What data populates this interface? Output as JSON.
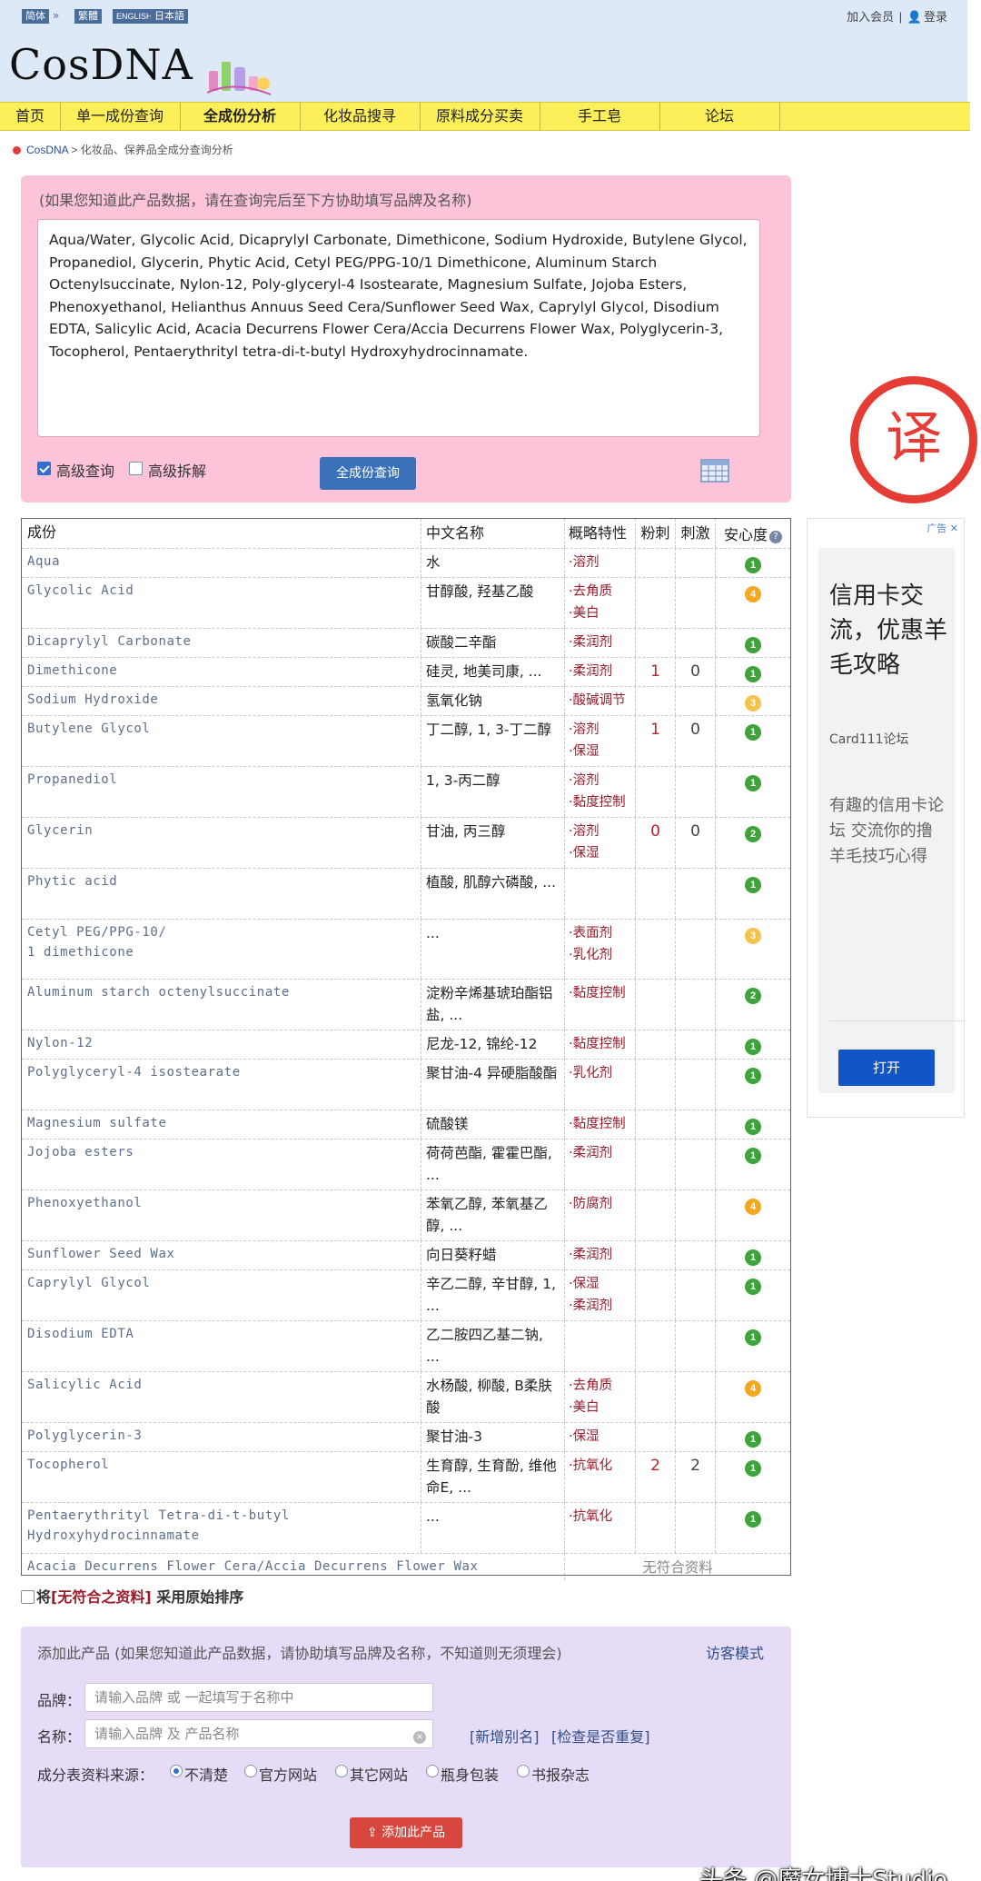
{
  "header": {
    "languages": [
      "简体",
      "繁體",
      "ENGLISH",
      "日本語"
    ],
    "join_member": "加入会员",
    "separator": "|",
    "login": "登录",
    "logo_text": "CosDNA"
  },
  "nav": {
    "items": [
      "首页",
      "单一成份查询",
      "全成份分析",
      "化妆品搜寻",
      "原料成分买卖",
      "手工皂",
      "论坛"
    ],
    "active_index": 2
  },
  "breadcrumb": {
    "home": "CosDNA",
    "separator": ">",
    "current": "化妆品、保养品全成分查询分析"
  },
  "query": {
    "hint": "(如果您知道此产品数据，请在查询完后至下方协助填写品牌及名称)",
    "ingredients_text": "Aqua/Water, Glycolic Acid, Dicaprylyl Carbonate, Dimethicone, Sodium Hydroxide, Butylene Glycol, Propanediol, Glycerin, Phytic Acid, Cetyl PEG/PPG-10/1 Dimethicone, Aluminum Starch Octenylsuccinate, Nylon-12, Poly-glyceryl-4 Isostearate, Magnesium Sulfate, Jojoba Esters, Phenoxyethanol, Helianthus Annuus Seed Cera/Sunflower Seed Wax, Caprylyl Glycol, Disodium EDTA, Salicylic Acid, Acacia Decurrens Flower Cera/Accia Decurrens Flower Wax, Polyglycerin-3, Tocopherol, Pentaerythrityl tetra-di-t-butyl Hydroxyhydrocinnamate.",
    "advanced_query_label": "高级查询",
    "advanced_query_checked": true,
    "advanced_split_label": "高级拆解",
    "advanced_split_checked": false,
    "submit_label": "全成份查询"
  },
  "translate_badge": "译",
  "table": {
    "headers": {
      "name": "成份",
      "chinese": "中文名称",
      "function": "概略特性",
      "acne": "粉刺",
      "irritant": "刺激",
      "safety": "安心度"
    },
    "help_icon_glyph": "?",
    "rows": [
      {
        "name": [
          "Aqua"
        ],
        "cn": "水",
        "fn": [
          "溶剂"
        ],
        "acne": "",
        "irr": "",
        "safety": "1",
        "lvl": "g"
      },
      {
        "name": [
          "Glycolic Acid"
        ],
        "cn": "甘醇酸, 羟基乙酸",
        "fn": [
          "去角质",
          "美白"
        ],
        "acne": "",
        "irr": "",
        "safety": "4",
        "lvl": "y"
      },
      {
        "name": [
          "Dicaprylyl Carbonate"
        ],
        "cn": "碳酸二辛酯",
        "fn": [
          "柔润剂"
        ],
        "acne": "",
        "irr": "",
        "safety": "1",
        "lvl": "g"
      },
      {
        "name": [
          "Dimethicone"
        ],
        "cn": "硅灵, 地美司康, ...",
        "fn": [
          "柔润剂"
        ],
        "acne": "1",
        "irr": "0",
        "safety": "1",
        "lvl": "g"
      },
      {
        "name": [
          "Sodium Hydroxide"
        ],
        "cn": "氢氧化钠",
        "fn": [
          "酸碱调节"
        ],
        "acne": "",
        "irr": "",
        "safety": "3",
        "lvl": "o"
      },
      {
        "name": [
          "Butylene Glycol"
        ],
        "cn": "丁二醇, 1, 3-丁二醇",
        "fn": [
          "溶剂",
          "保湿"
        ],
        "acne": "1",
        "irr": "0",
        "safety": "1",
        "lvl": "g"
      },
      {
        "name": [
          "Propanediol"
        ],
        "cn": "1, 3-丙二醇",
        "fn": [
          "溶剂",
          "黏度控制"
        ],
        "acne": "",
        "irr": "",
        "safety": "1",
        "lvl": "g"
      },
      {
        "name": [
          "Glycerin"
        ],
        "cn": "甘油, 丙三醇",
        "fn": [
          "溶剂",
          "保湿"
        ],
        "acne": "0",
        "irr": "0",
        "safety": "2",
        "lvl": "g"
      },
      {
        "name": [
          "Phytic acid"
        ],
        "cn": "植酸, 肌醇六磷酸, ...",
        "fn": [],
        "acne": "",
        "irr": "",
        "safety": "1",
        "lvl": "g"
      },
      {
        "name": [
          "Cetyl PEG/PPG-10/",
          "1 dimethicone"
        ],
        "cn": "...",
        "fn": [
          "表面剂",
          "乳化剂"
        ],
        "acne": "",
        "irr": "",
        "safety": "3",
        "lvl": "o"
      },
      {
        "name": [
          "Aluminum starch octenylsuccinate"
        ],
        "cn": "淀粉辛烯基琥珀酯铝盐, ...",
        "fn": [
          "黏度控制"
        ],
        "acne": "",
        "irr": "",
        "safety": "2",
        "lvl": "g"
      },
      {
        "name": [
          "Nylon-12"
        ],
        "cn": "尼龙-12, 锦纶-12",
        "fn": [
          "黏度控制"
        ],
        "acne": "",
        "irr": "",
        "safety": "1",
        "lvl": "g"
      },
      {
        "name": [
          "Polyglyceryl-4 isostearate"
        ],
        "cn": "聚甘油-4 异硬脂酸酯",
        "fn": [
          "乳化剂"
        ],
        "acne": "",
        "irr": "",
        "safety": "1",
        "lvl": "g"
      },
      {
        "name": [
          "Magnesium sulfate"
        ],
        "cn": "硫酸镁",
        "fn": [
          "黏度控制"
        ],
        "acne": "",
        "irr": "",
        "safety": "1",
        "lvl": "g"
      },
      {
        "name": [
          "Jojoba esters"
        ],
        "cn": "荷荷芭酯, 霍霍巴酯, ...",
        "fn": [
          "柔润剂"
        ],
        "acne": "",
        "irr": "",
        "safety": "1",
        "lvl": "g"
      },
      {
        "name": [
          "Phenoxyethanol"
        ],
        "cn": "苯氧乙醇, 苯氧基乙醇, ...",
        "fn": [
          "防腐剂"
        ],
        "acne": "",
        "irr": "",
        "safety": "4",
        "lvl": "y"
      },
      {
        "name": [
          "Sunflower Seed Wax"
        ],
        "cn": "向日葵籽蜡",
        "fn": [
          "柔润剂"
        ],
        "acne": "",
        "irr": "",
        "safety": "1",
        "lvl": "g"
      },
      {
        "name": [
          "Caprylyl Glycol"
        ],
        "cn": "辛乙二醇, 辛甘醇, 1, ...",
        "fn": [
          "保湿",
          "柔润剂"
        ],
        "acne": "",
        "irr": "",
        "safety": "1",
        "lvl": "g"
      },
      {
        "name": [
          "Disodium EDTA"
        ],
        "cn": "乙二胺四乙基二钠, ...",
        "fn": [],
        "acne": "",
        "irr": "",
        "safety": "1",
        "lvl": "g"
      },
      {
        "name": [
          "Salicylic Acid"
        ],
        "cn": "水杨酸, 柳酸, B柔肤酸",
        "fn": [
          "去角质",
          "美白"
        ],
        "acne": "",
        "irr": "",
        "safety": "4",
        "lvl": "y"
      },
      {
        "name": [
          "Polyglycerin-3"
        ],
        "cn": "聚甘油-3",
        "fn": [
          "保湿"
        ],
        "acne": "",
        "irr": "",
        "safety": "1",
        "lvl": "g"
      },
      {
        "name": [
          "Tocopherol"
        ],
        "cn": "生育醇, 生育酚, 维他命E, ...",
        "fn": [
          "抗氧化"
        ],
        "acne": "2",
        "irr": "2",
        "safety": "1",
        "lvl": "g"
      },
      {
        "name": [
          "Pentaerythrityl Tetra-di-t-butyl",
          "Hydroxyhydrocinnamate"
        ],
        "cn": "...",
        "fn": [
          "抗氧化"
        ],
        "acne": "",
        "irr": "",
        "safety": "1",
        "lvl": "g"
      }
    ],
    "unmatched": {
      "name": "Acacia Decurrens Flower Cera/Accia Decurrens Flower Wax",
      "label": "无符合资料"
    }
  },
  "sort_option": {
    "prefix": "将",
    "highlight": "[无符合之资料]",
    "suffix": "采用原始排序"
  },
  "add_product": {
    "title": "添加此产品 (如果您知道此产品数据，请协助填写品牌及名称，不知道则无须理会)",
    "guest_mode": "访客模式",
    "brand_label": "品牌：",
    "brand_placeholder": "请输入品牌 或 一起填写于名称中",
    "name_label": "名称：",
    "name_placeholder": "请输入品牌 及 产品名称",
    "clear_glyph": "×",
    "link_alias": "[新增别名]",
    "link_check": "[检查是否重复]",
    "source_label": "成分表资料来源：",
    "sources": [
      "不清楚",
      "官方网站",
      "其它网站",
      "瓶身包装",
      "书报杂志"
    ],
    "source_selected": 0,
    "submit_label": "添加此产品"
  },
  "ad": {
    "tag": "广告",
    "headline": "信用卡交流，优惠羊毛攻略",
    "sponsor": "Card111论坛",
    "description": "有趣的信用卡论坛 交流你的撸羊毛技巧心得",
    "button": "打开"
  },
  "watermark": "头条 @魔女博士Studio",
  "colors": {
    "header_bg": "#dde9f6",
    "nav_bg": "#fcef5a",
    "query_bg": "#fcc3d9",
    "add_bg": "#e6dcf8",
    "primary_button": "#3a71b8",
    "danger_button": "#d8473d",
    "safety_green": "#3fa33d",
    "safety_yellow": "#f2a81f"
  }
}
